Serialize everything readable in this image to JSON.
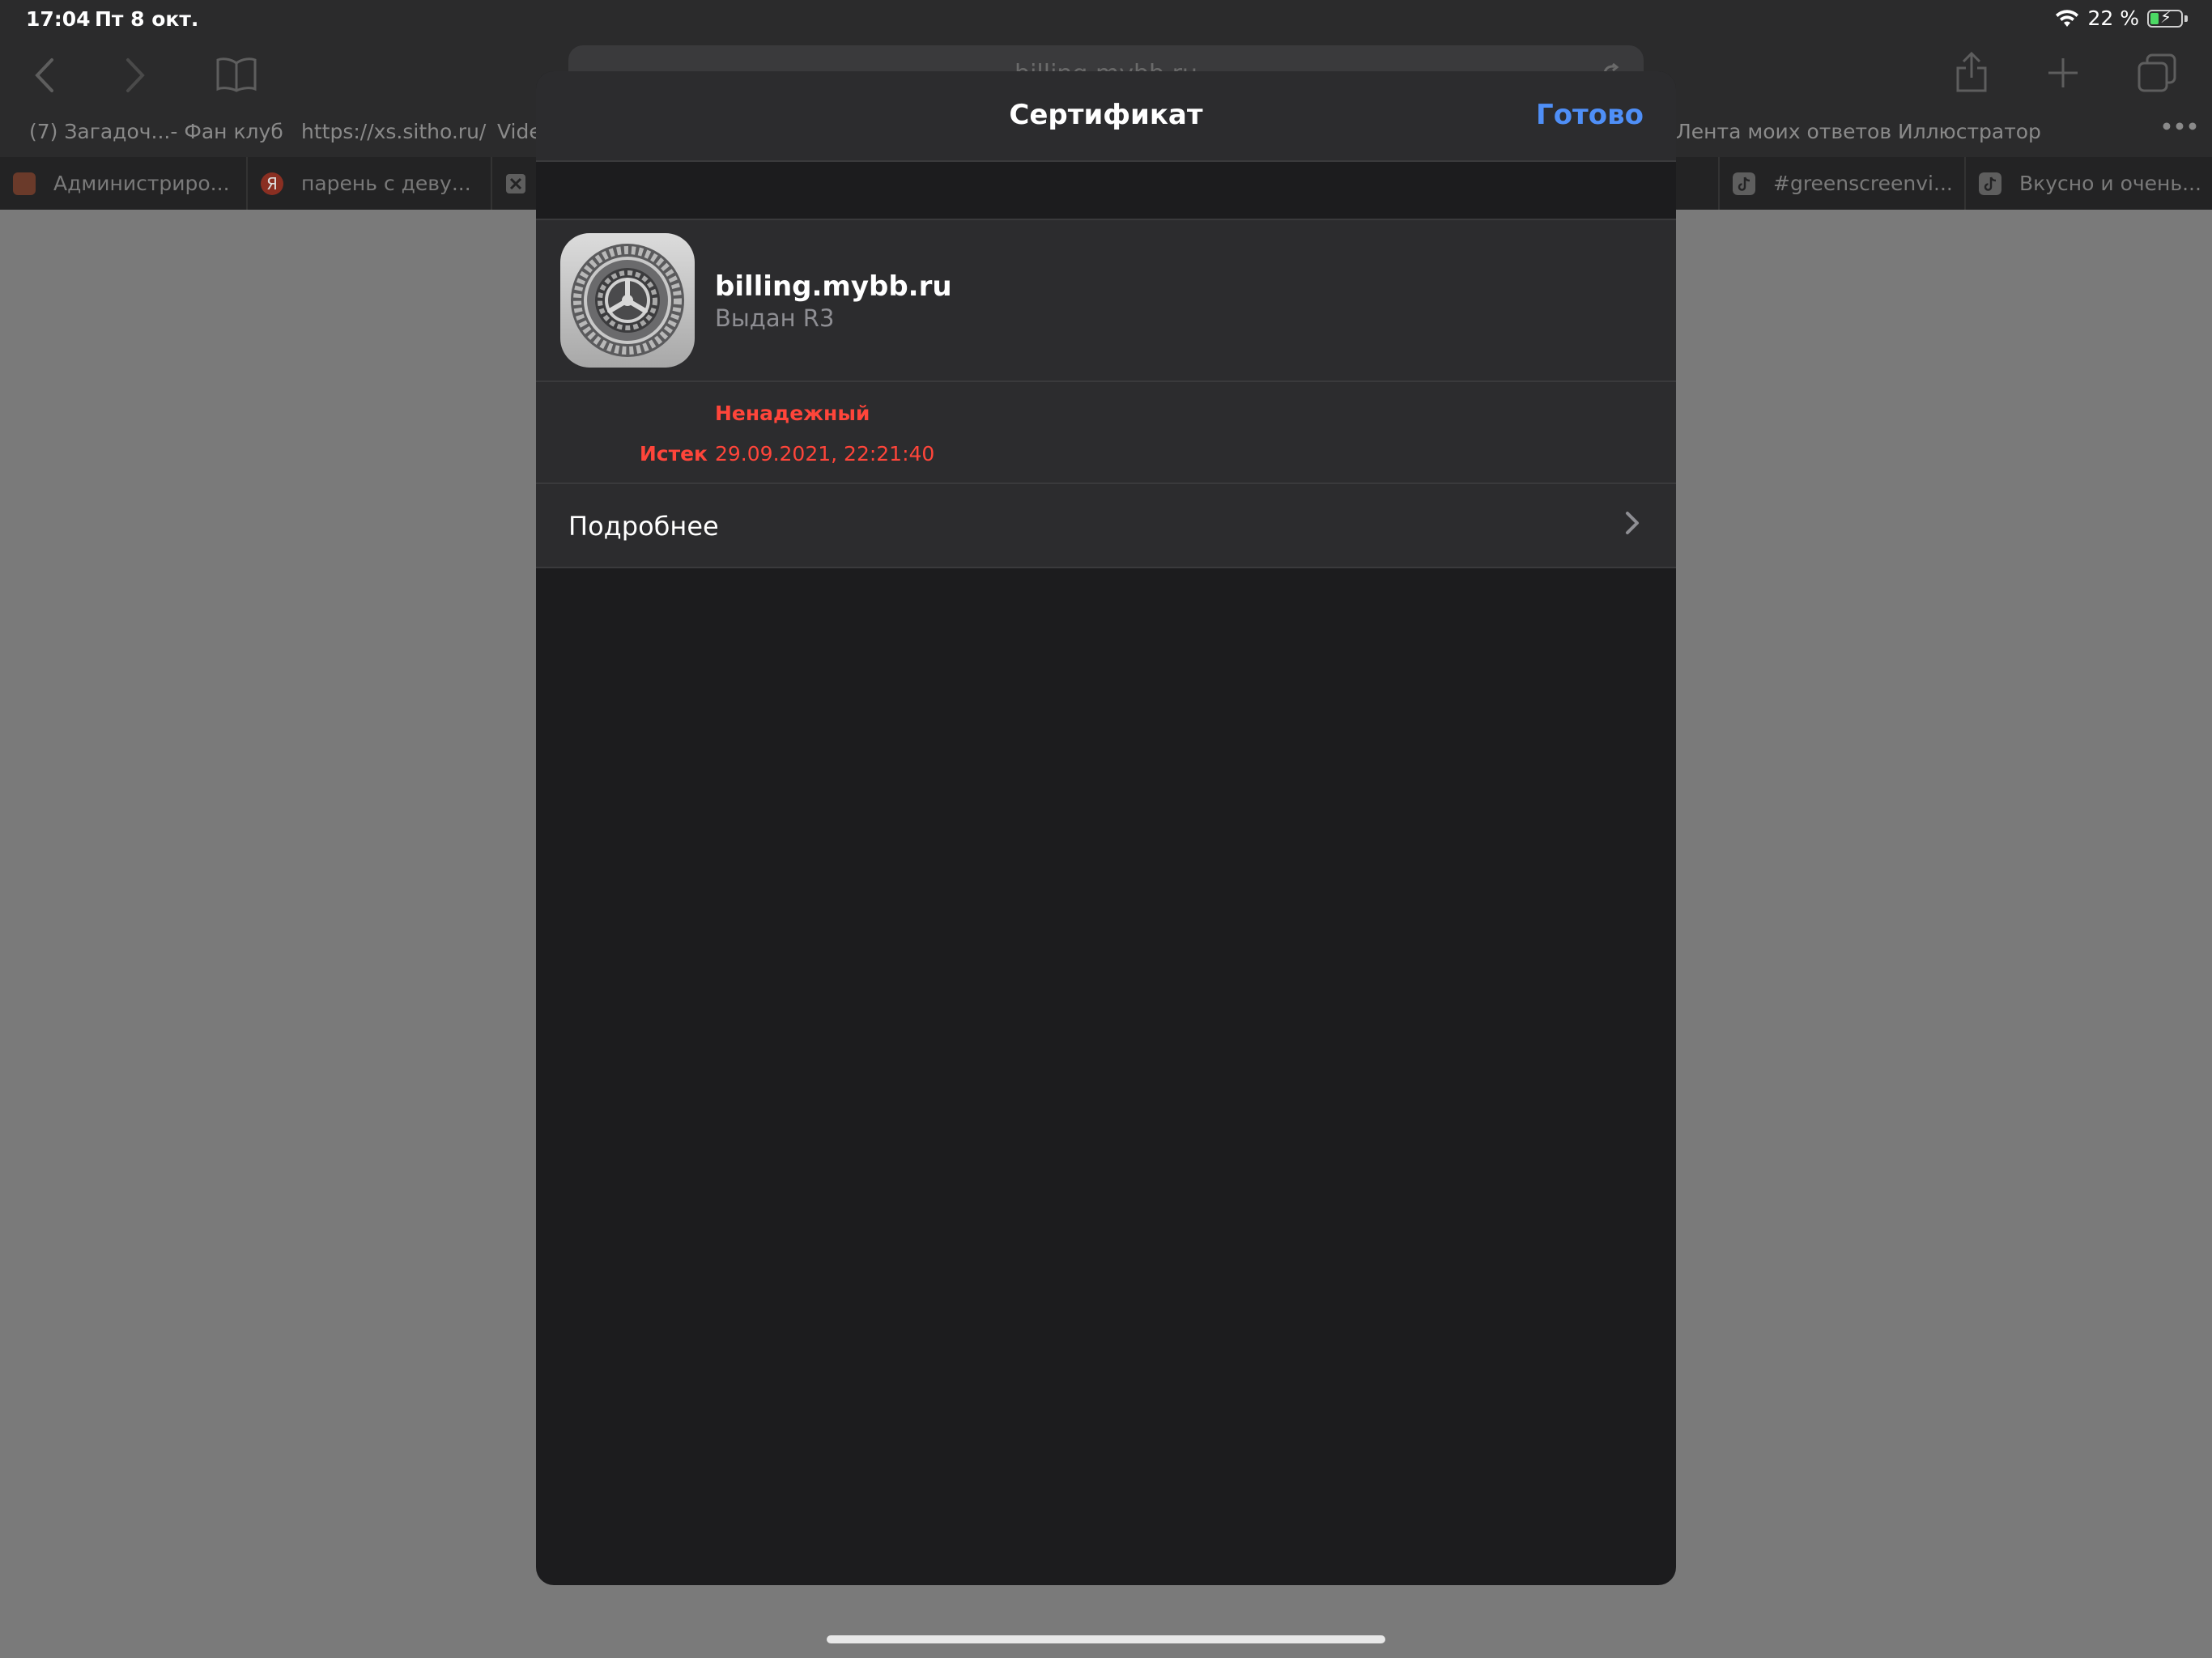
{
  "status_bar": {
    "time": "17:04",
    "date": "Пт 8 окт.",
    "battery": "22 %"
  },
  "browser": {
    "url": "billing.mybb.ru",
    "bookmarks": [
      "(7) Загадоч...- Фан клуб",
      "https://xs.sitho.ru/",
      "Vide",
      "Лента моих ответов",
      "Иллюстратор"
    ],
    "more": "•••",
    "tabs": [
      "Администриро...",
      "парень с деву...",
      "#greenscreenvi...",
      "Вкусно и очень..."
    ],
    "yandex_letter": "Я"
  },
  "sheet": {
    "title": "Сертификат",
    "done_label": "Готово",
    "cert_name": "billing.mybb.ru",
    "cert_issuer": "Выдан R3",
    "trust_status": "Ненадежный",
    "expired_label": "Истек",
    "expired_value": "29.09.2021, 22:21:40",
    "more_label": "Подробнее"
  },
  "colors": {
    "accent": "#4f8ff7",
    "danger": "#ff453a",
    "sheet_bg": "#1c1c1e",
    "card_bg": "#2c2c2e"
  },
  "icons": {
    "back": "chevron-left-icon",
    "forward": "chevron-right-icon",
    "bookmarks": "book-icon",
    "share": "share-icon",
    "new_tab": "plus-icon",
    "tabs": "tabs-icon",
    "reload": "reload-icon",
    "wifi": "wifi-icon",
    "battery": "battery-icon",
    "certificate": "gear-icon",
    "disclosure": "chevron-right-icon"
  }
}
